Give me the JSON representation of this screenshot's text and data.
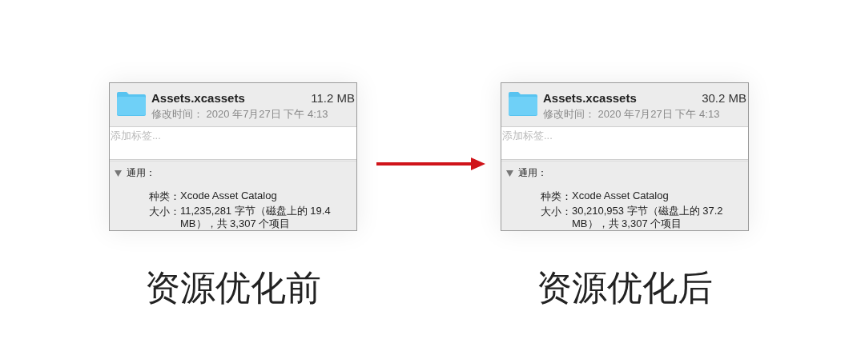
{
  "panels": [
    {
      "name": "Assets.xcassets",
      "size": "11.2 MB",
      "modified": "修改时间： 2020 年7月27日 下午 4:13",
      "tags_placeholder": "添加标签...",
      "section": {
        "title": "通用：",
        "expanded": true,
        "rows": [
          {
            "label": "种类：",
            "value": "Xcode Asset Catalog"
          },
          {
            "label": "大小：",
            "value": "11,235,281 字节（磁盘上的 19.4 MB），共 3,307 个项目"
          }
        ]
      },
      "caption": "资源优化前"
    },
    {
      "name": "Assets.xcassets",
      "size": "30.2 MB",
      "modified": "修改时间： 2020 年7月27日 下午 4:13",
      "tags_placeholder": "添加标签...",
      "section": {
        "title": "通用：",
        "expanded": true,
        "rows": [
          {
            "label": "种类：",
            "value": "Xcode Asset Catalog"
          },
          {
            "label": "大小：",
            "value": "30,210,953 字节（磁盘上的 37.2 MB），共 3,307 个项目"
          }
        ]
      },
      "caption": "资源优化后"
    }
  ]
}
